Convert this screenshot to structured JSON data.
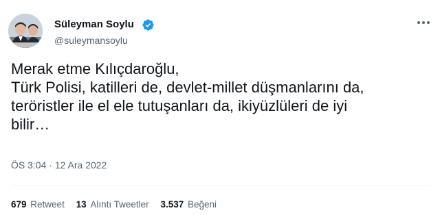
{
  "author": {
    "name": "Süleyman Soylu",
    "handle": "@suleymansoylu"
  },
  "tweet": {
    "lines": [
      "Merak etme Kılıçdaroğlu,",
      "Türk Polisi, katilleri de, devlet-millet düşmanlarını da,",
      "teröristler ile el ele tutuşanları da, ikiyüzlüleri de iyi",
      "bilir…"
    ],
    "time": "ÖS 3:04",
    "separator": "·",
    "date": "12 Ara 2022"
  },
  "stats": {
    "retweets": {
      "count": "679",
      "label": "Retweet"
    },
    "quotes": {
      "count": "13",
      "label": "Alıntı Tweetler"
    },
    "likes": {
      "count": "3.537",
      "label": "Beğeni"
    }
  },
  "colors": {
    "text": "#0f1419",
    "muted": "#536471",
    "verified": "#1d9bf0",
    "divider": "#eff3f4"
  },
  "icons": [
    "verified-badge-icon",
    "more-options-icon"
  ]
}
